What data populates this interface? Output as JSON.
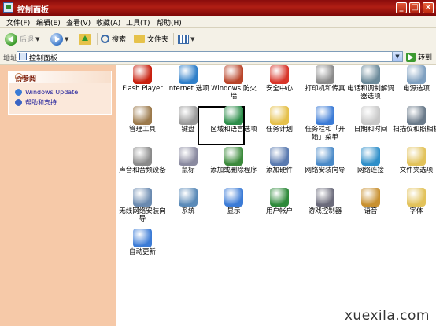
{
  "window": {
    "title": "控制面板"
  },
  "title_buttons": [
    "_",
    "□",
    "×"
  ],
  "menu": [
    "文件(F)",
    "编辑(E)",
    "查看(V)",
    "收藏(A)",
    "工具(T)",
    "帮助(H)"
  ],
  "toolbar": {
    "back_label": "后退",
    "search_label": "搜索",
    "folders_label": "文件夹"
  },
  "address": {
    "label": "地址(D)",
    "value": "控制面板",
    "go_label": "转到"
  },
  "left_panel": {
    "heading": "请参阅",
    "links": [
      {
        "label": "Windows Update",
        "icon": "windows-update-icon",
        "color": "#3b7bd6"
      },
      {
        "label": "帮助和支持",
        "icon": "help-icon",
        "color": "#3a64c4"
      }
    ]
  },
  "items": [
    {
      "label": "Flash Player",
      "icon": "flash-player-icon",
      "color": "#c8200f"
    },
    {
      "label": "Internet 选项",
      "icon": "internet-options-icon",
      "color": "#2f7fc9"
    },
    {
      "label": "Windows 防火墙",
      "icon": "firewall-icon",
      "color": "#b9452a"
    },
    {
      "label": "安全中心",
      "icon": "security-center-icon",
      "color": "#d8352a"
    },
    {
      "label": "打印机和传真",
      "icon": "printer-icon",
      "color": "#8a8a8a"
    },
    {
      "label": "电话和调制解调器选项",
      "icon": "phone-modem-icon",
      "color": "#6b8a9a"
    },
    {
      "label": "电源选项",
      "icon": "power-options-icon",
      "color": "#7fa0c0"
    },
    {
      "label": "管理工具",
      "icon": "admin-tools-icon",
      "color": "#9c7a4c"
    },
    {
      "label": "键盘",
      "icon": "keyboard-icon",
      "color": "#9a9a9a"
    },
    {
      "label": "区域和语言选项",
      "icon": "region-language-icon",
      "color": "#2c8d4a"
    },
    {
      "label": "任务计划",
      "icon": "scheduled-tasks-icon",
      "color": "#e5c04a"
    },
    {
      "label": "任务栏和「开始」菜单",
      "icon": "taskbar-icon",
      "color": "#3b7bd6"
    },
    {
      "label": "日期和时间",
      "icon": "date-time-icon",
      "color": "#c8c8c8"
    },
    {
      "label": "扫描仪和照相机",
      "icon": "scanner-camera-icon",
      "color": "#6a7a8a"
    },
    {
      "label": "声音和音频设备",
      "icon": "sound-icon",
      "color": "#8a8a8a"
    },
    {
      "label": "鼠标",
      "icon": "mouse-icon",
      "color": "#8a8aa0"
    },
    {
      "label": "添加或删除程序",
      "icon": "add-remove-programs-icon",
      "color": "#3b8a3b"
    },
    {
      "label": "添加硬件",
      "icon": "add-hardware-icon",
      "color": "#5a7ab0"
    },
    {
      "label": "网络安装向导",
      "icon": "network-setup-icon",
      "color": "#4a8ac8"
    },
    {
      "label": "网络连接",
      "icon": "network-connections-icon",
      "color": "#2f8fc9"
    },
    {
      "label": "文件夹选项",
      "icon": "folder-options-icon",
      "color": "#e2c25a"
    },
    {
      "label": "无线网络安装向导",
      "icon": "wireless-setup-icon",
      "color": "#6a8ab0"
    },
    {
      "label": "系统",
      "icon": "system-icon",
      "color": "#5a8ab8"
    },
    {
      "label": "显示",
      "icon": "display-icon",
      "color": "#3b7bd6"
    },
    {
      "label": "用户帐户",
      "icon": "user-accounts-icon",
      "color": "#2e8a3a"
    },
    {
      "label": "游戏控制器",
      "icon": "game-controller-icon",
      "color": "#6a6a7a"
    },
    {
      "label": "语音",
      "icon": "speech-icon",
      "color": "#c89030"
    },
    {
      "label": "字体",
      "icon": "fonts-icon",
      "color": "#e2c25a"
    },
    {
      "label": "自动更新",
      "icon": "automatic-updates-icon",
      "color": "#3b7bd6"
    }
  ],
  "watermark": "xuexila.com"
}
